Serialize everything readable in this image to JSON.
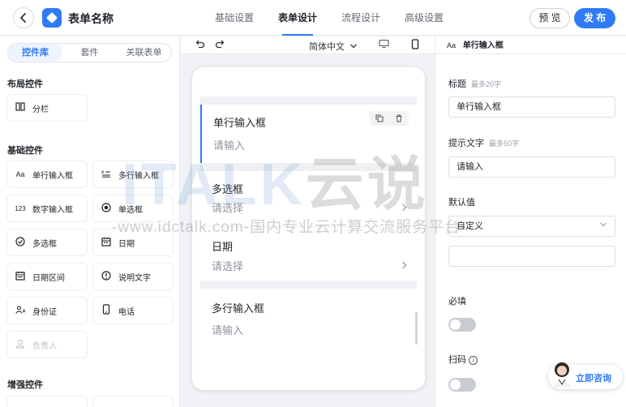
{
  "header": {
    "back_icon": "chevron-left-icon",
    "logo_icon": "diamond-logo-icon",
    "title": "表单名称",
    "tabs": [
      {
        "label": "基础设置",
        "active": false
      },
      {
        "label": "表单设计",
        "active": true
      },
      {
        "label": "流程设计",
        "active": false
      },
      {
        "label": "高级设置",
        "active": false
      }
    ],
    "preview_label": "预 览",
    "publish_label": "发 布",
    "accent_color": "#2f7bf6"
  },
  "library": {
    "tabs": [
      {
        "label": "控件库",
        "active": true
      },
      {
        "label": "套件",
        "active": false
      },
      {
        "label": "关联表单",
        "active": false
      }
    ],
    "layout_title": "布局控件",
    "layout_controls": [
      {
        "label": "分栏",
        "icon": "columns-icon"
      }
    ],
    "basic_title": "基础控件",
    "basic_controls": [
      {
        "label": "单行输入框",
        "icon": "text-aa-icon"
      },
      {
        "label": "多行输入框",
        "icon": "multiline-text-icon"
      },
      {
        "label": "数字输入框",
        "icon": "number-123-icon"
      },
      {
        "label": "单选框",
        "icon": "radio-icon"
      },
      {
        "label": "多选框",
        "icon": "checkbox-circle-icon"
      },
      {
        "label": "日期",
        "icon": "calendar-icon"
      },
      {
        "label": "日期区间",
        "icon": "calendar-range-icon"
      },
      {
        "label": "说明文字",
        "icon": "info-circle-icon"
      },
      {
        "label": "身份证",
        "icon": "id-card-icon"
      },
      {
        "label": "电话",
        "icon": "phone-icon"
      },
      {
        "label": "负责人",
        "icon": "person-icon",
        "disabled": true
      }
    ],
    "enhanced_title": "增强控件"
  },
  "toolbar": {
    "undo_icon": "undo-icon",
    "redo_icon": "redo-icon",
    "language": "简体中文",
    "desktop_icon": "desktop-icon",
    "mobile_icon": "mobile-icon"
  },
  "canvas": {
    "fields": [
      {
        "label": "单行输入框",
        "placeholder": "请输入",
        "selected": true
      },
      {
        "label": "多选框",
        "placeholder": "请选择",
        "has_chevron": true
      },
      {
        "label": "日期",
        "placeholder": "请选择",
        "has_chevron": true
      },
      {
        "label": "多行输入框",
        "placeholder": "请输入"
      }
    ],
    "copy_icon": "copy-icon",
    "delete_icon": "trash-icon"
  },
  "properties": {
    "header_icon": "Aa",
    "header": "单行输入框",
    "title_label": "标题",
    "title_hint": "最多20字",
    "title_value": "单行输入框",
    "hint_label": "提示文字",
    "hint_hint": "最多50字",
    "hint_value": "请输入",
    "default_label": "默认值",
    "default_select": "自定义",
    "default_value": "",
    "required_label": "必填",
    "scan_label": "扫码",
    "required_on": false,
    "scan_on": false
  },
  "consult": {
    "label": "立即咨询"
  },
  "watermark": {
    "logo_text": "ITALK",
    "logo_cn": "云说",
    "line": "-www.idctalk.com-国内专业云计算交流服务平台-"
  }
}
